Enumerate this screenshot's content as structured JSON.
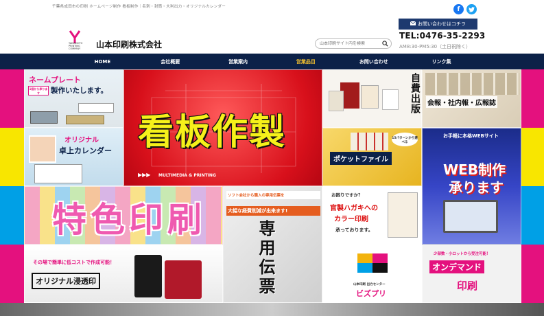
{
  "header": {
    "tagline": "千葉県成田市の印刷 ホームページ制作 看板制作｜名刺・封筒・大判出力・オリジナルカレンダー",
    "social": {
      "facebook": "f",
      "twitter": "t"
    },
    "contact_button": "お問い合わせはコチラ",
    "tel": "TEL:0476-35-2293",
    "hours": "AM8:30-PM5:30（土日祝除く）",
    "logo_sub": "YAMAMOTO PRINTING COMPANY",
    "company_name": "山本印刷株式会社",
    "search_placeholder": "山本印刷サイト内を検索"
  },
  "nav": {
    "items": [
      {
        "label": "HOME",
        "active": false
      },
      {
        "label": "会社概要",
        "active": false
      },
      {
        "label": "営業案内",
        "active": false
      },
      {
        "label": "営業品目",
        "active": true
      },
      {
        "label": "お問い合わせ",
        "active": false
      },
      {
        "label": "リンク集",
        "active": false
      }
    ]
  },
  "tiles": {
    "nameplate": {
      "line1": "ネームプレート",
      "line2": "製作いたします。",
      "badge": "1個から承ります"
    },
    "kanban": {
      "title": "看板作製",
      "sub": "MULTIMEDIA & PRINTING"
    },
    "jihi": {
      "title": "自費出版"
    },
    "kaihou": {
      "title": "会報・社内報・広報誌"
    },
    "calendar": {
      "line1": "オリジナル",
      "line2": "卓上カレンダー"
    },
    "pocket": {
      "title": "ポケットファイル",
      "badge": "15パターンから選べる"
    },
    "web": {
      "line0": "お手軽に本格WEBサイト",
      "line1": "WEB制作",
      "line2": "承ります"
    },
    "tokushoku": {
      "title": "特色印刷"
    },
    "senyou": {
      "title": "専用伝票",
      "note1": "ソフト会社から購入の専用伝票を",
      "note2": "大幅な経費削減が出来ます!"
    },
    "hagaki": {
      "q": "お困りですか？",
      "line1": "官製ハガキへの",
      "line2": "カラー印刷",
      "line3": "承っております。"
    },
    "shintou": {
      "note": "その場で簡単に低コストで作成可能！",
      "title": "オリジナル浸透印"
    },
    "bizpri": {
      "sub": "山本印刷 出力センター",
      "title": "ビズプリ"
    },
    "ondemand": {
      "note": "少部数・小ロットから受注可能！",
      "line1": "オンデマンド",
      "line2": "印刷"
    }
  },
  "colors": {
    "nav_bg": "#0c2148",
    "nav_active": "#f3c02f",
    "stripe_pink": "#e4117e",
    "stripe_yellow": "#f8e600",
    "stripe_blue": "#00a0e6",
    "contact_btn": "#1e3a6f"
  }
}
